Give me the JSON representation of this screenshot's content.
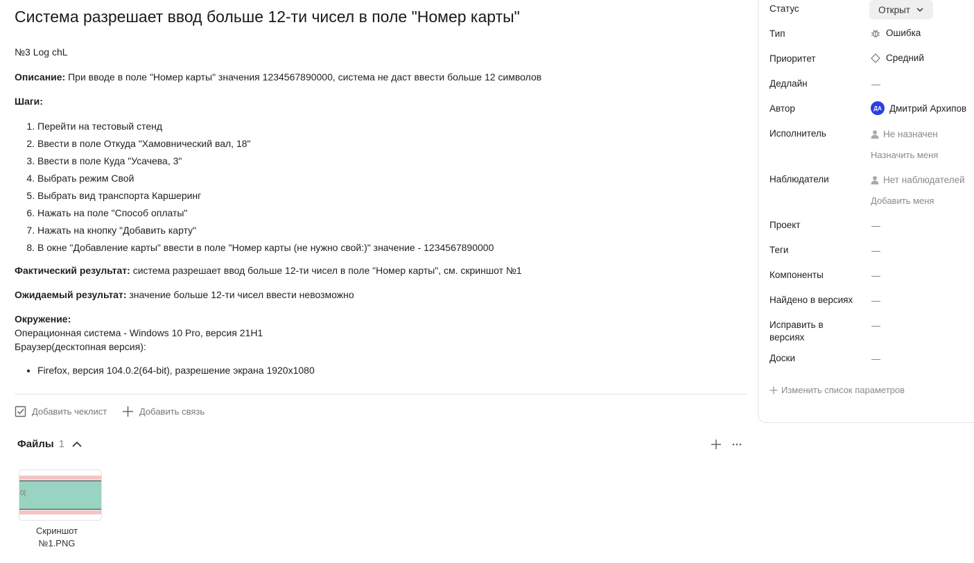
{
  "issue": {
    "title": "Система разрешает ввод больше 12-ти чисел в поле \"Номер карты\"",
    "meta": "№3 Log chL",
    "description_label": "Описание:",
    "description_text": " При вводе в поле \"Номер карты\" значения 1234567890000, система не даст ввести больше 12 символов",
    "steps_label": "Шаги:",
    "steps": [
      "Перейти на тестовый стенд",
      "Ввести в поле Откуда \"Хамовнический вал, 18\"",
      "Ввести в поле Куда \"Усачева, 3\"",
      "Выбрать режим Свой",
      "Выбрать вид транспорта Каршеринг",
      "Нажать на поле \"Способ оплаты\"",
      "Нажать на кнопку \"Добавить карту\"",
      "В окне \"Добавление карты\" ввести в поле \"Номер карты (не нужно свой:)\" значение - 1234567890000"
    ],
    "actual_label": "Фактический результат:",
    "actual_text": " система разрешает ввод больше 12-ти чисел в поле \"Номер карты\", см. скриншот №1",
    "expected_label": "Ожидаемый результат:",
    "expected_text": " значение больше 12-ти чисел ввести невозможно",
    "env_label": "Окружение:",
    "env_os": "Операционная система - Windows 10 Pro, версия 21H1",
    "env_browser": "Браузер(десктопная версия):",
    "env_items": [
      "Firefox, версия 104.0.2(64-bit), разрешение экрана 1920x1080"
    ]
  },
  "actions": {
    "checklist": "Добавить чеклист",
    "link": "Добавить связь"
  },
  "files": {
    "label": "Файлы",
    "count": "1",
    "items": [
      {
        "name": "Скриншот №1.PNG",
        "thumb_text": "0|"
      }
    ]
  },
  "sidebar": {
    "status": {
      "label": "Статус",
      "value": "Открыт"
    },
    "type": {
      "label": "Тип",
      "value": "Ошибка"
    },
    "priority": {
      "label": "Приоритет",
      "value": "Средний"
    },
    "deadline": {
      "label": "Дедлайн",
      "value": "—"
    },
    "author": {
      "label": "Автор",
      "initials": "ДА",
      "value": "Дмитрий Архипов"
    },
    "assignee": {
      "label": "Исполнитель",
      "value": "Не назначен",
      "action": "Назначить меня"
    },
    "followers": {
      "label": "Наблюдатели",
      "value": "Нет наблюдателей",
      "action": "Добавить меня"
    },
    "project": {
      "label": "Проект",
      "value": "—"
    },
    "tags": {
      "label": "Теги",
      "value": "—"
    },
    "components": {
      "label": "Компоненты",
      "value": "—"
    },
    "found_in": {
      "label": "Найдено в версиях",
      "value": "—"
    },
    "fix_in": {
      "label": "Исправить в версиях",
      "value": "—"
    },
    "boards": {
      "label": "Доски",
      "value": "—"
    },
    "edit_params": "Изменить список параметров"
  }
}
